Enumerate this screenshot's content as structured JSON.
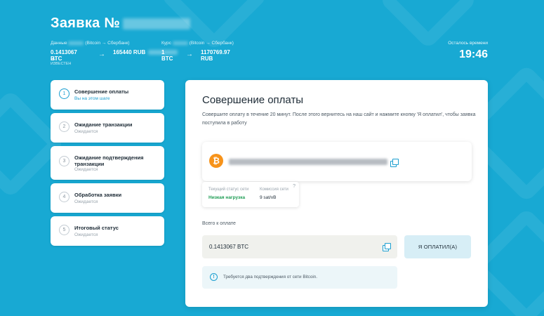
{
  "header": {
    "title": "Заявка №",
    "data_caption_prefix": "Данные",
    "data_caption_suffix": "(Bitcoin → Сбербанк)",
    "rate_caption_prefix": "Курс",
    "rate_caption_suffix": "(Bitcoin → Сбербанк)",
    "give_amount": "0.1413067 BTC",
    "give_sub": "НЕ ИЗВЕСТЕН",
    "get_amount": "165440 RUB",
    "rate_from": "1 BTC",
    "rate_to": "1170769.97 RUB",
    "arrow": "→"
  },
  "timer": {
    "caption": "Осталось времени",
    "value": "19:46"
  },
  "steps": [
    {
      "num": "1",
      "label": "Совершение оплаты",
      "status": "Вы на этом шаге"
    },
    {
      "num": "2",
      "label": "Ожидание транзакции",
      "status": "Ожидается"
    },
    {
      "num": "3",
      "label": "Ожидание подтверждения транзакции",
      "status": "Ожидается"
    },
    {
      "num": "4",
      "label": "Обработка заявки",
      "status": "Ожидается"
    },
    {
      "num": "5",
      "label": "Итоговый статус",
      "status": "Ожидается"
    }
  ],
  "panel": {
    "title": "Совершение оплаты",
    "description": "Совершите оплату в течение 20 минут. После этого вернитесь на наш сайт и нажмите кнопку 'Я оплатил', чтобы заявка поступила в работу",
    "coin_symbol": "₿",
    "network": {
      "status_caption": "Текущий статус сети",
      "status_value": "Низкая нагрузка",
      "fee_caption": "Комиссия сети",
      "fee_value": "9 sat/vB",
      "help": "?"
    },
    "total_caption": "Всего к оплате",
    "total_value": "0.1413067 BTC",
    "paid_button": "Я ОПЛАТИЛ(А)",
    "notice_icon": "!",
    "notice": "Требуется два подтверждения от сети Bitcoin."
  },
  "colors": {
    "background": "#18a9d3",
    "accent": "#1b9ed0",
    "bitcoin": "#f7931a",
    "low_load": "#1f9d55"
  }
}
